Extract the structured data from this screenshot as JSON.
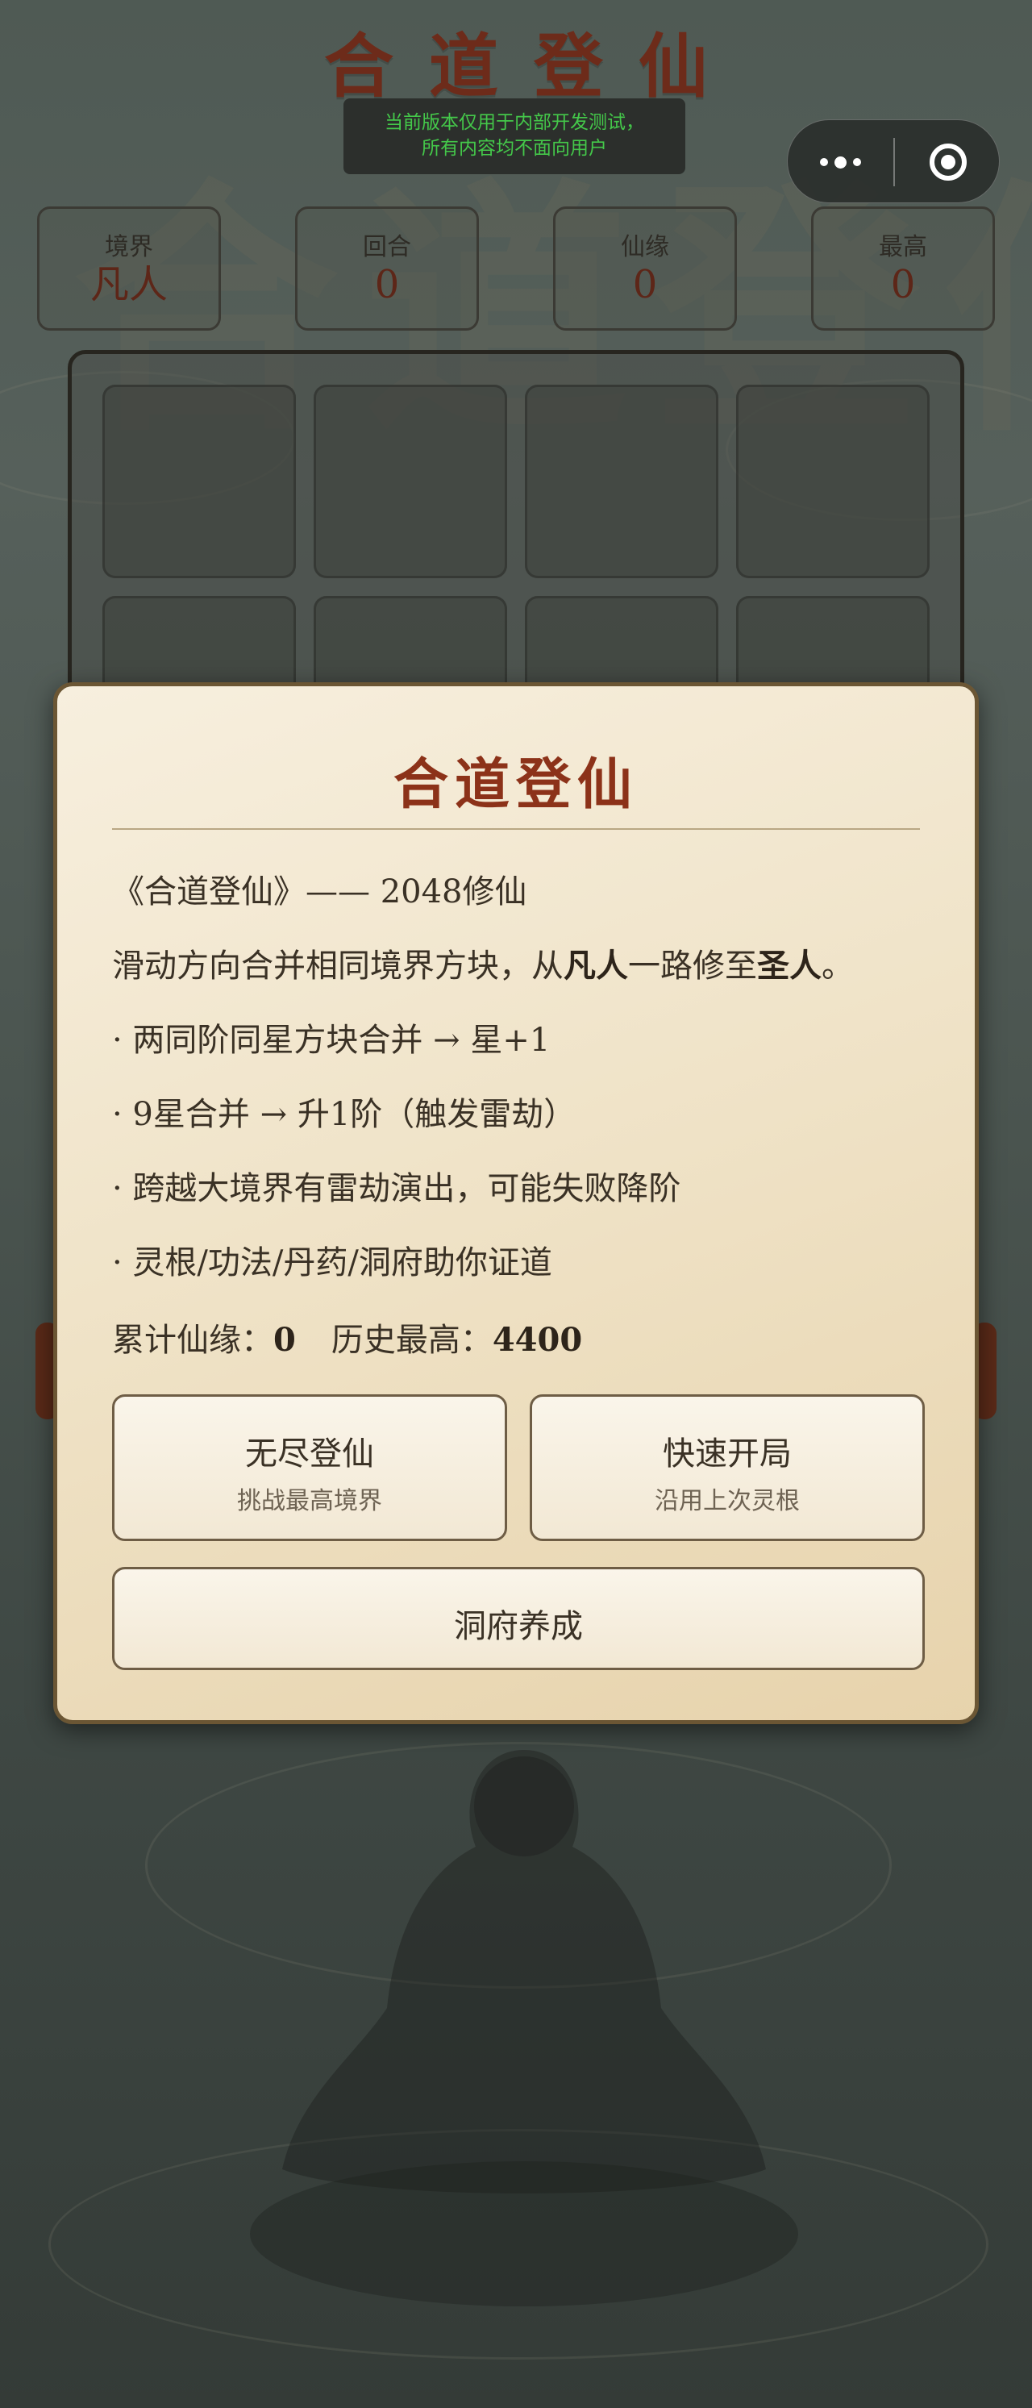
{
  "app": {
    "title": "合道登仙",
    "dev_notice_line1": "当前版本仅用于内部开发测试，",
    "dev_notice_line2": "所有内容均不面向用户"
  },
  "capsule": {
    "more_icon": "more-dots-icon",
    "close_icon": "target-close-icon"
  },
  "stats": [
    {
      "label": "境界",
      "value": "凡人"
    },
    {
      "label": "回合",
      "value": "0"
    },
    {
      "label": "仙缘",
      "value": "0"
    },
    {
      "label": "最高",
      "value": "0"
    }
  ],
  "modal": {
    "title": "合道登仙",
    "subtitle": "《合道登仙》—— 2048修仙",
    "intro_pre": "滑动方向合并相同境界方块，从",
    "intro_b1": "凡人",
    "intro_mid": "一路修至",
    "intro_b2": "圣人",
    "intro_post": "。",
    "rules": [
      "· 两同阶同星方块合并 → 星+1",
      "· 9星合并 → 升1阶（触发雷劫）",
      "· 跨越大境界有雷劫演出，可能失败降阶",
      "· 灵根/功法/丹药/洞府助你证道"
    ],
    "total_label": "累计仙缘：",
    "total_value": "0",
    "best_label": "历史最高：",
    "best_value": "4400",
    "btn_endless_main": "无尽登仙",
    "btn_endless_sub": "挑战最高境界",
    "btn_quick_main": "快速开局",
    "btn_quick_sub": "沿用上次灵根",
    "btn_cave": "洞府养成"
  },
  "colors": {
    "accent": "#8c3219",
    "notice_text": "#44c84a",
    "panel": "#efe2c6"
  }
}
